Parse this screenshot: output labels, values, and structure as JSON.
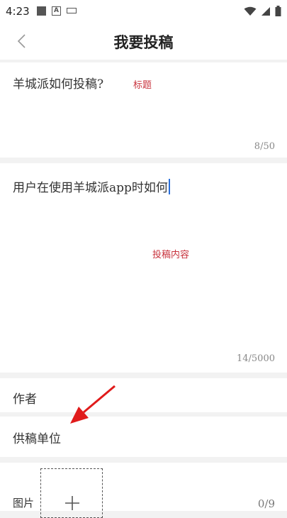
{
  "status_bar": {
    "time": "4:23",
    "icons": [
      "notification-square-icon",
      "a-badge-icon",
      "keyboard-icon",
      "wifi-icon",
      "signal-icon",
      "battery-icon"
    ]
  },
  "nav": {
    "back_icon": "chevron-left-icon",
    "title": "我要投稿"
  },
  "title_field": {
    "value": "羊城派如何投稿?",
    "annotation": "标题",
    "counter": "8/50"
  },
  "content_field": {
    "value": "用户在使用羊城派app时如何",
    "annotation": "投稿内容",
    "counter": "14/5000"
  },
  "author_field": {
    "label": "作者"
  },
  "unit_field": {
    "label": "供稿单位"
  },
  "image_field": {
    "label": "图片",
    "counter": "0/9",
    "add_icon": "plus-icon"
  },
  "colors": {
    "annotation": "#c8323c",
    "arrow": "#e01b1b",
    "cursor": "#2a6fdb",
    "background": "#f2f2f2"
  }
}
